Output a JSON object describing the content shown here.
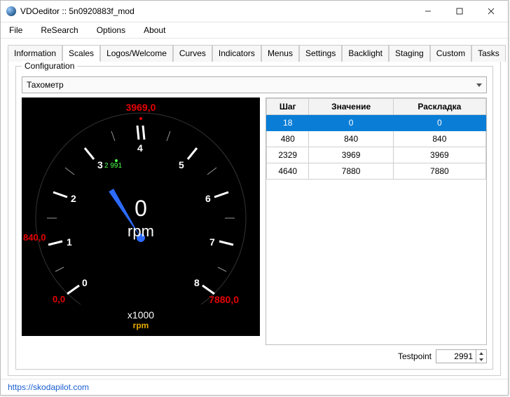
{
  "window": {
    "title": "VDOeditor :: 5n0920883f_mod"
  },
  "menu": {
    "file": "File",
    "research": "ReSearch",
    "options": "Options",
    "about": "About"
  },
  "tabs": {
    "items": [
      "Information",
      "Scales",
      "Logos/Welcome",
      "Curves",
      "Indicators",
      "Menus",
      "Settings",
      "Backlight",
      "Staging",
      "Custom",
      "Tasks"
    ],
    "active_index": 1
  },
  "group": {
    "label": "Configuration"
  },
  "combo": {
    "selected": "Тахометр"
  },
  "gauge": {
    "value": "0",
    "unit": "rpm",
    "multiplier": "x1000",
    "bottom_unit": "rpm",
    "marker_top": "3969,0",
    "marker_left": "840,0",
    "marker_origin": "0,0",
    "marker_right": "7880,0",
    "probe": "2 991",
    "ticks": {
      "t0": "0",
      "t1": "1",
      "t2": "2",
      "t3": "3",
      "t4": "4",
      "t5": "5",
      "t6": "6",
      "t7": "7",
      "t8": "8"
    }
  },
  "table": {
    "headers": {
      "step": "Шаг",
      "value": "Значение",
      "layout": "Раскладка"
    },
    "rows": [
      {
        "step": "18",
        "value": "0",
        "layout": "0",
        "selected": true
      },
      {
        "step": "480",
        "value": "840",
        "layout": "840"
      },
      {
        "step": "2329",
        "value": "3969",
        "layout": "3969"
      },
      {
        "step": "4640",
        "value": "7880",
        "layout": "7880"
      }
    ]
  },
  "testpoint": {
    "label": "Testpoint",
    "value": "2991"
  },
  "status": {
    "link": "https://skodapilot.com"
  }
}
